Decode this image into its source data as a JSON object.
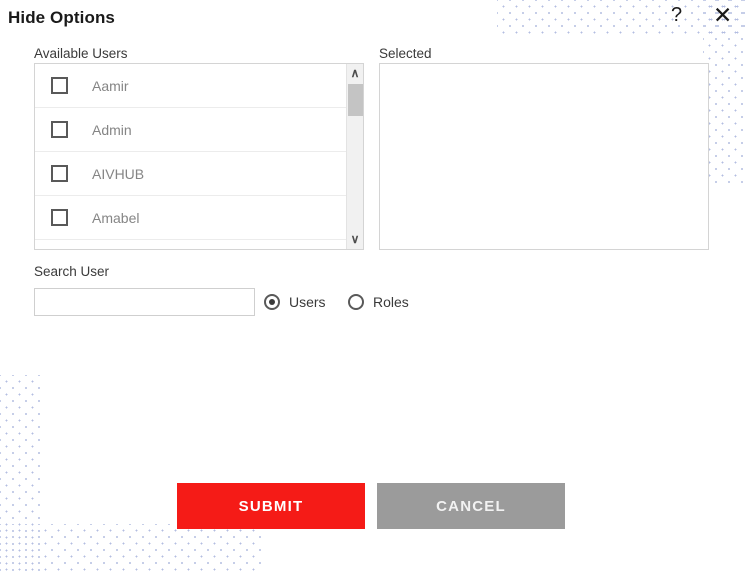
{
  "dialog": {
    "title": "Hide Options",
    "help_icon_glyph": "?",
    "close_icon_glyph": "✕"
  },
  "panels": {
    "available": {
      "label": "Available Users",
      "rows": [
        {
          "label": "Aamir",
          "checked": false
        },
        {
          "label": "Admin",
          "checked": false
        },
        {
          "label": "AIVHUB",
          "checked": false
        },
        {
          "label": "Amabel",
          "checked": false
        }
      ]
    },
    "selected": {
      "label": "Selected",
      "rows": []
    }
  },
  "scrollbar": {
    "up_arrow_glyph": "∧",
    "down_arrow_glyph": "∨"
  },
  "search": {
    "label": "Search User",
    "value": "",
    "placeholder": "",
    "radios": [
      {
        "label": "Users",
        "checked": true
      },
      {
        "label": "Roles",
        "checked": false
      }
    ]
  },
  "actions": {
    "submit_label": "SUBMIT",
    "cancel_label": "CANCEL"
  },
  "colors": {
    "submit_red": "#F51B17",
    "cancel_gray": "#9B9B9B",
    "dot_pattern": "#9AA7D8",
    "list_border": "#D4D4D4",
    "row_text": "#858585"
  }
}
